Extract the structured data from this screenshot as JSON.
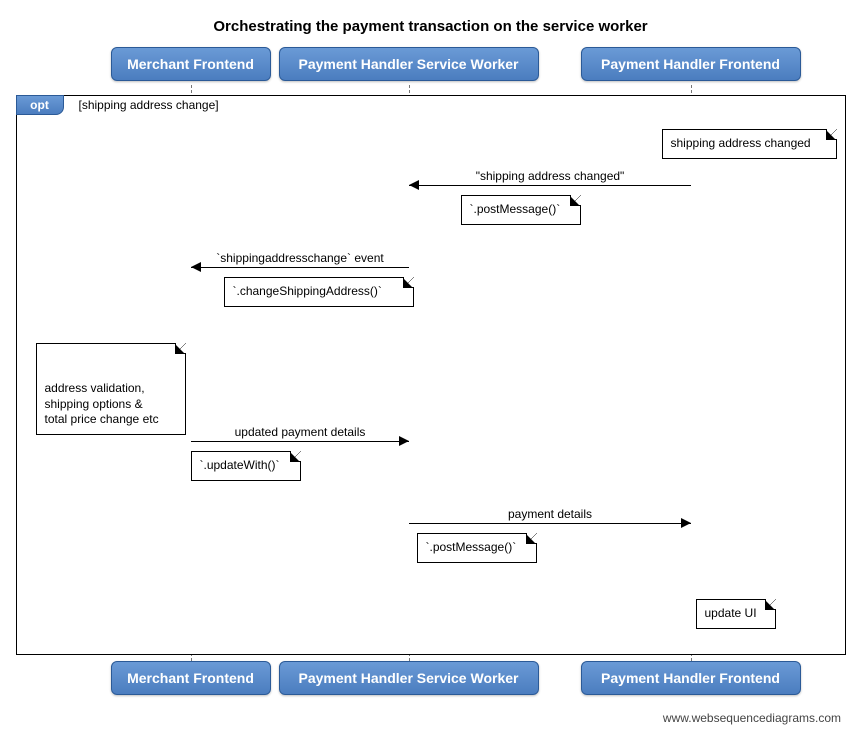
{
  "title": "Orchestrating the payment transaction on the service worker",
  "participants": {
    "merchant": "Merchant Frontend",
    "sw": "Payment Handler Service Worker",
    "frontend": "Payment Handler Frontend"
  },
  "opt": {
    "tag": "opt",
    "guard": "[shipping address change]"
  },
  "notes": {
    "phf_start": "shipping address changed",
    "merchant_validation": "address validation,\nshipping options &\ntotal price change etc",
    "phf_update": "update UI"
  },
  "messages": {
    "m1_label": "\"shipping address changed\"",
    "m1_note": "`.postMessage()`",
    "m2_label": "`shippingaddresschange` event",
    "m2_note": "`.changeShippingAddress()`",
    "m3_label": "updated payment details",
    "m3_note": "`.updateWith()`",
    "m4_label": "payment details",
    "m4_note": "`.postMessage()`"
  },
  "attribution": "www.websequencediagrams.com"
}
